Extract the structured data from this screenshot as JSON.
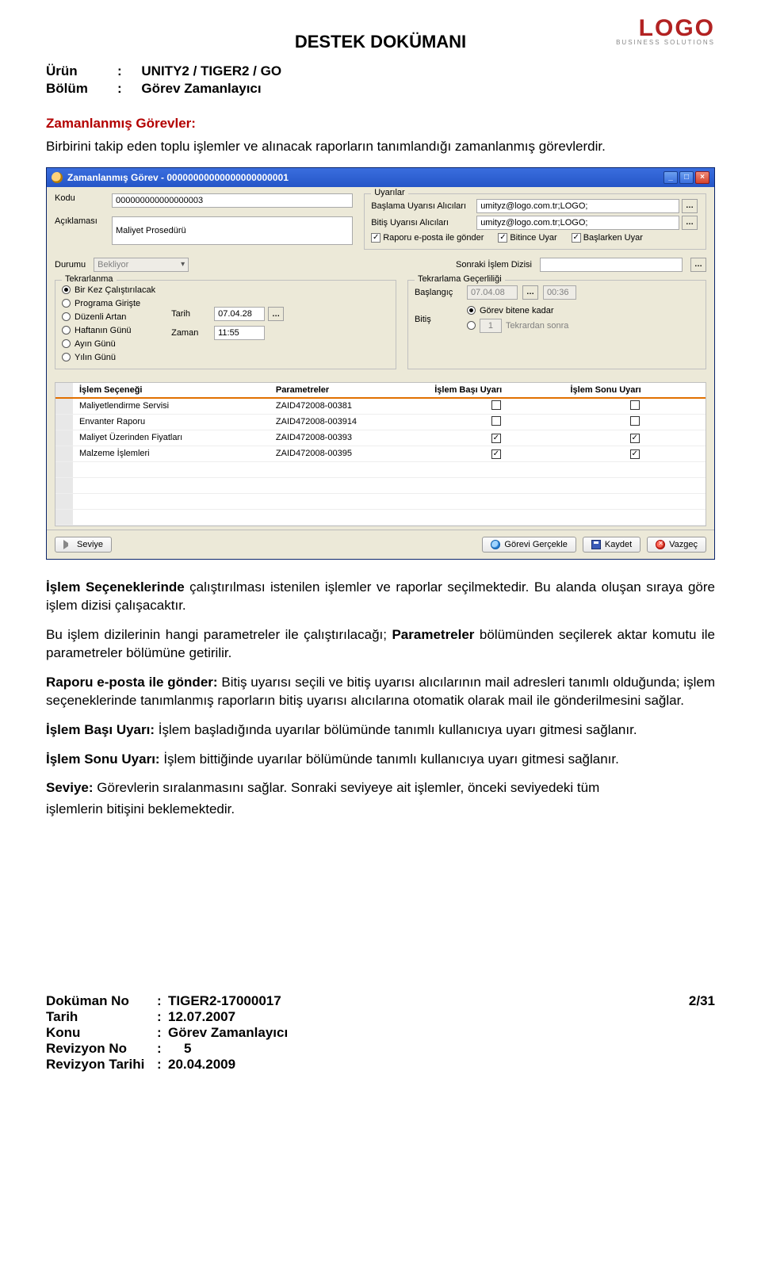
{
  "logo": {
    "text": "LOGO",
    "sub": "BUSINESS   SOLUTIONS"
  },
  "doc_title": "DESTEK DOKÜMANI",
  "meta": {
    "urun_label": "Ürün",
    "urun_value": "UNITY2 / TIGER2 / GO",
    "bolum_label": "Bölüm",
    "bolum_value": "Görev Zamanlayıcı"
  },
  "section_head": "Zamanlanmış Görevler:",
  "intro": "Birbirini takip eden toplu işlemler ve alınacak raporların tanımlandığı zamanlanmış görevlerdir.",
  "window": {
    "title": "Zamanlanmış Görev - 00000000000000000000001",
    "labels": {
      "kodu": "Kodu",
      "aciklamasi": "Açıklaması",
      "durumu": "Durumu",
      "sonraki": "Sonraki İşlem Dizisi",
      "uyarilar": "Uyarılar",
      "baslama_alici": "Başlama Uyarısı Alıcıları",
      "bitis_alici": "Bitiş Uyarısı Alıcıları",
      "rapor_eposta": "Raporu e-posta ile gönder",
      "bitince_uyar": "Bitince Uyar",
      "baslarken_uyar": "Başlarken Uyar",
      "tekrarlanma": "Tekrarlanma",
      "tek_gecer": "Tekrarlama Geçerliliği",
      "bir_kez": "Bir Kez Çalıştırılacak",
      "prog_girite": "Programa Girişte",
      "duzenli": "Düzenli Artan",
      "haftanin": "Haftanın Günü",
      "ayn": "Ayın Günü",
      "yilin": "Yılın Günü",
      "tarih": "Tarih",
      "zaman": "Zaman",
      "baslangic": "Başlangıç",
      "bitis": "Bitiş",
      "gorev_bitene": "Görev bitene kadar",
      "tekrardan_sonra": "Tekrardan sonra"
    },
    "values": {
      "kodu": "000000000000000003",
      "aciklamasi": "Maliyet Prosedürü",
      "durumu": "Bekliyor",
      "baslama_alici": "umityz@logo.com.tr;LOGO;",
      "bitis_alici": "umityz@logo.com.tr;LOGO;",
      "tarih": "07.04.28",
      "zaman": "11:55",
      "baslangic_tarih": "07.04.08",
      "baslangic_saat": "00:36",
      "tekrar_sayi": "1"
    },
    "table": {
      "cols": [
        "İşlem Seçeneği",
        "Parametreler",
        "İşlem Başı Uyarı",
        "İşlem Sonu Uyarı"
      ],
      "rows": [
        {
          "islem": "Maliyetlendirme Servisi",
          "param": "ZAID472008-00381",
          "bas": false,
          "son": false
        },
        {
          "islem": "Envanter Raporu",
          "param": "ZAID472008-003914",
          "bas": false,
          "son": false
        },
        {
          "islem": "Maliyet Üzerinden Fiyatları",
          "param": "ZAID472008-00393",
          "bas": true,
          "son": true
        },
        {
          "islem": "Malzeme İşlemleri",
          "param": "ZAID472008-00395",
          "bas": true,
          "son": true
        }
      ]
    },
    "buttons": {
      "seviye": "Seviye",
      "gercek": "Görevi Gerçekle",
      "kaydet": "Kaydet",
      "vazgec": "Vazgeç"
    }
  },
  "para_islem_sec_lead": "İşlem Seçeneklerinde",
  "para_islem_sec_rest": " çalıştırılması istenilen işlemler ve raporlar seçilmektedir. Bu alanda oluşan sıraya göre işlem dizisi çalışacaktır.",
  "para_dizi_lead": "Parametreler",
  "para_dizi": "Bu işlem dizilerinin hangi parametreler ile çalıştırılacağı; ",
  "para_dizi_rest": " bölümünden seçilerek aktar komutu ile parametreler bölümüne getirilir.",
  "para_eposta_lead": "Raporu e-posta ile gönder:",
  "para_eposta_rest": " Bitiş uyarısı seçili ve bitiş uyarısı alıcılarının mail adresleri tanımlı olduğunda; işlem seçeneklerinde tanımlanmış raporların bitiş uyarısı alıcılarına otomatik olarak  mail ile gönderilmesini sağlar.",
  "para_basi_lead": "İşlem Başı Uyarı:",
  "para_basi_rest": " İşlem başladığında uyarılar bölümünde tanımlı kullanıcıya uyarı gitmesi sağlanır.",
  "para_sonu_lead": "İşlem Sonu Uyarı:",
  "para_sonu_rest": " İşlem bittiğinde uyarılar bölümünde tanımlı kullanıcıya uyarı gitmesi sağlanır.",
  "para_seviye_lead": "Seviye:",
  "para_seviye_rest": " Görevlerin sıralanmasını sağlar. Sonraki seviyeye ait işlemler, önceki seviyedeki tüm",
  "para_seviye_tail": "işlemlerin bitişini beklemektedir.",
  "footer": {
    "dokno_l": "Doküman No",
    "dokno_v": "TIGER2-17000017",
    "tarih_l": "Tarih",
    "tarih_v": "12.07.2007",
    "konu_l": "Konu",
    "konu_v": "Görev Zamanlayıcı",
    "revno_l": "Revizyon No",
    "revno_v": "5",
    "revt_l": "Revizyon Tarihi",
    "revt_v": "20.04.2009",
    "page": "2/31"
  }
}
